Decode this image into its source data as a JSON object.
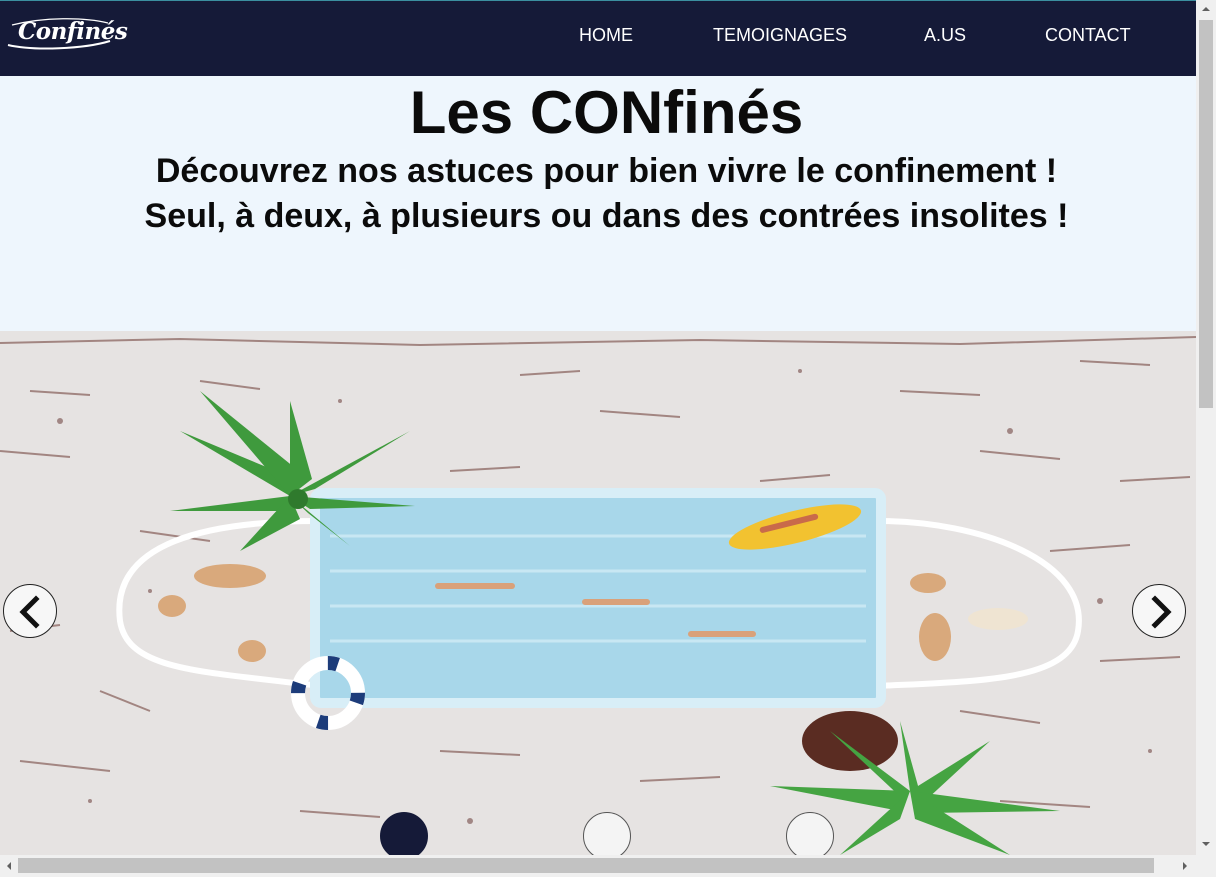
{
  "brand": {
    "logo_text": "Confinés"
  },
  "nav": {
    "items": [
      {
        "label": "HOME"
      },
      {
        "label": "TEMOIGNAGES"
      },
      {
        "label": "A.US"
      },
      {
        "label": "CONTACT"
      }
    ]
  },
  "hero": {
    "title": "Les CONfinés",
    "subtitle_line1": "Découvrez nos astuces pour bien vivre le confinement !",
    "subtitle_line2": "Seul, à deux, à plusieurs ou dans des contrées insolites !"
  },
  "carousel": {
    "slide_description_icon": "mask-pool-photo",
    "slide_count": 3,
    "active_slide": 1,
    "prev_icon": "chevron-left-icon",
    "next_icon": "chevron-right-icon"
  },
  "colors": {
    "nav_bg": "#151a38",
    "page_bg": "#eef6fd",
    "active_dot": "#151a38",
    "inactive_dot": "#f4f4f4"
  }
}
